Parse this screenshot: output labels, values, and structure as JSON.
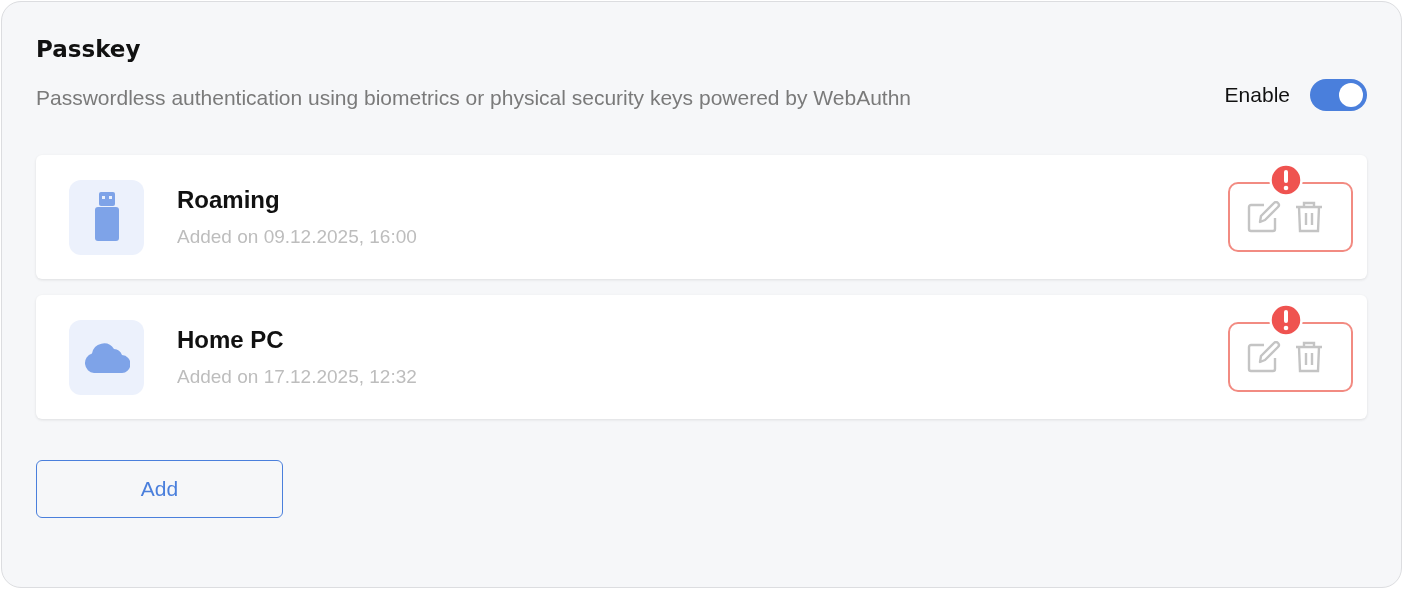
{
  "title": "Passkey",
  "description": "Passwordless authentication using biometrics or physical security keys powered by WebAuthn",
  "enable": {
    "label": "Enable",
    "on": true
  },
  "keys": [
    {
      "kind": "usb",
      "name": "Roaming",
      "added": "Added on 09.12.2025, 16:00",
      "flagged": true
    },
    {
      "kind": "cloud",
      "name": "Home PC",
      "added": "Added on 17.12.2025, 12:32",
      "flagged": true
    }
  ],
  "add_button": "Add"
}
